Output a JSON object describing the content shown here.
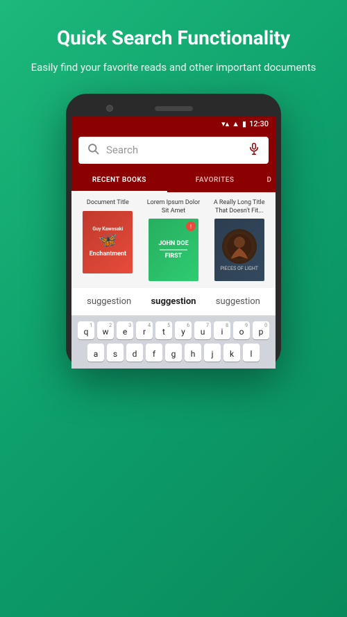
{
  "header": {
    "title": "Quick Search Functionality",
    "subtitle": "Easily find your favorite reads and other important documents"
  },
  "status_bar": {
    "time": "12:30"
  },
  "search": {
    "placeholder": "Search"
  },
  "tabs": [
    {
      "label": "RECENT BOOKS",
      "active": true
    },
    {
      "label": "FAVORITES",
      "active": false
    },
    {
      "label": "D",
      "active": false
    }
  ],
  "books": [
    {
      "title": "Document Title",
      "author": "Guy Kawasaki",
      "name": "Enchantment"
    },
    {
      "title": "Lorem Ipsum Dolor Sit Amet",
      "author": "FIRST",
      "badge": "!"
    },
    {
      "title": "A Really Long Title That Doesn't Fit...",
      "subtitle": "PIECES OF LIGHT"
    }
  ],
  "suggestions": [
    {
      "text": "suggestion",
      "bold": false
    },
    {
      "text": "suggestion",
      "bold": true
    },
    {
      "text": "suggestion",
      "bold": false
    }
  ],
  "keyboard": {
    "rows": [
      [
        {
          "letter": "q",
          "number": "1"
        },
        {
          "letter": "w",
          "number": "2"
        },
        {
          "letter": "e",
          "number": "3"
        },
        {
          "letter": "r",
          "number": "4"
        },
        {
          "letter": "t",
          "number": "5"
        },
        {
          "letter": "y",
          "number": "6"
        },
        {
          "letter": "u",
          "number": "7"
        },
        {
          "letter": "i",
          "number": "8"
        },
        {
          "letter": "o",
          "number": "9"
        },
        {
          "letter": "p",
          "number": "0"
        }
      ],
      [
        {
          "letter": "a",
          "number": ""
        },
        {
          "letter": "s",
          "number": ""
        },
        {
          "letter": "d",
          "number": ""
        },
        {
          "letter": "f",
          "number": ""
        },
        {
          "letter": "g",
          "number": ""
        },
        {
          "letter": "h",
          "number": ""
        },
        {
          "letter": "j",
          "number": ""
        },
        {
          "letter": "k",
          "number": ""
        },
        {
          "letter": "l",
          "number": ""
        }
      ]
    ]
  }
}
